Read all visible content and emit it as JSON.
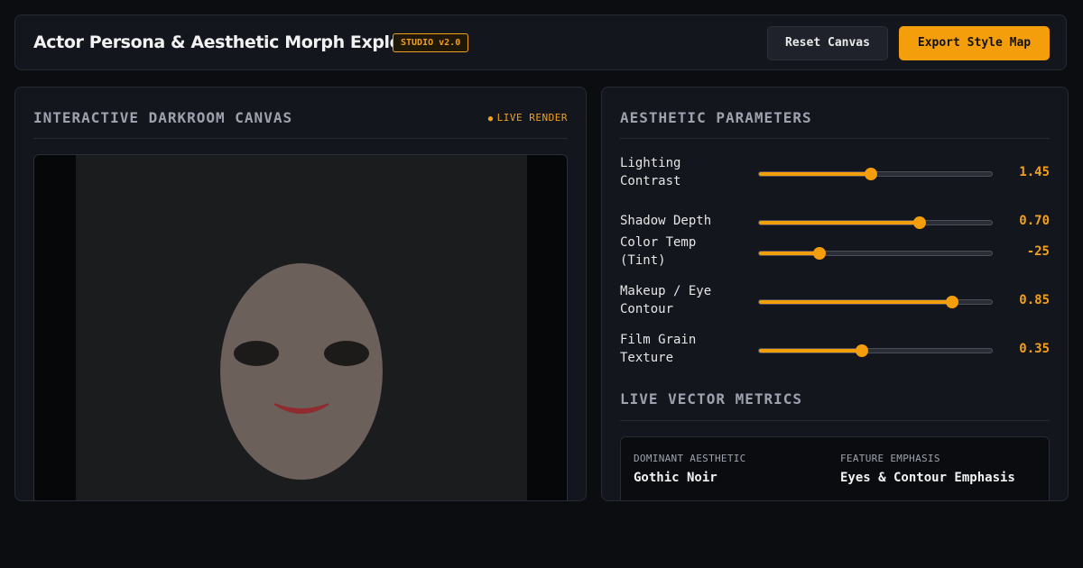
{
  "header": {
    "title": "Actor Persona & Aesthetic Morph Explorer",
    "badge": "STUDIO v2.0",
    "reset_label": "Reset Canvas",
    "export_label": "Export Style Map"
  },
  "canvas_panel": {
    "title": "INTERACTIVE DARKROOM CANVAS",
    "live_indicator": "LIVE RENDER"
  },
  "params_panel": {
    "title": "AESTHETIC PARAMETERS",
    "params": [
      {
        "label": "Lighting Contrast",
        "value": "1.45",
        "level": 0.48
      },
      {
        "label": "Shadow Depth",
        "value": "0.70",
        "level": 0.69
      },
      {
        "label": "Color Temp (Tint)",
        "value": "-25",
        "level": 0.26
      },
      {
        "label": "Makeup / Eye Contour",
        "value": "0.85",
        "level": 0.83
      },
      {
        "label": "Film Grain Texture",
        "value": "0.35",
        "level": 0.44
      }
    ]
  },
  "metrics": {
    "title": "LIVE VECTOR METRICS",
    "items": [
      {
        "label": "DOMINANT AESTHETIC",
        "value": "Gothic Noir"
      },
      {
        "label": "FEATURE EMPHASIS",
        "value": "Eyes & Contour Emphasis"
      }
    ]
  },
  "colors": {
    "accent": "#f59e0b",
    "background": "#0c0d11",
    "panel": "#14161e",
    "face": "#6b605a",
    "lips": "#8f2c30"
  }
}
